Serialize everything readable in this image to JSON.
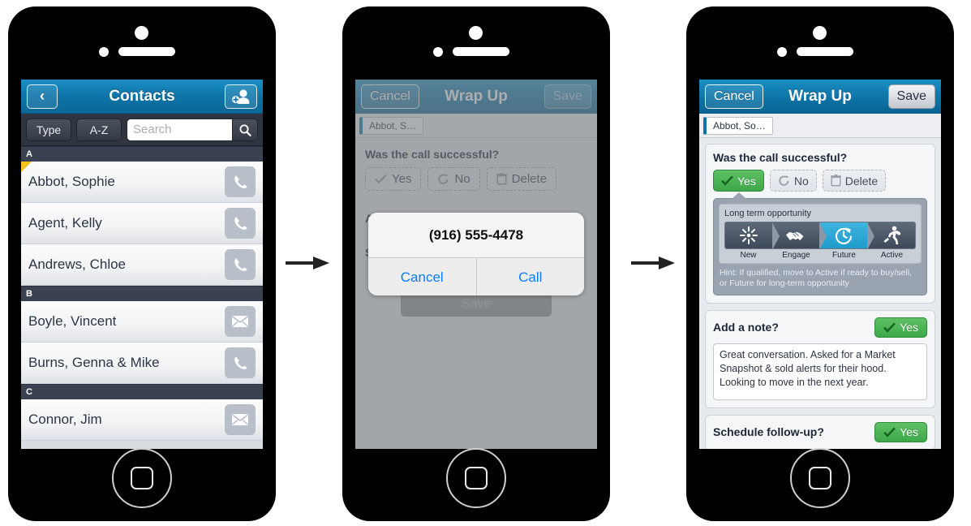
{
  "phones": [
    {
      "id": "contacts-phone"
    },
    {
      "id": "call-confirm-phone"
    },
    {
      "id": "wrapup-phone"
    }
  ],
  "screen1": {
    "navbar": {
      "back_label": "‹",
      "title": "Contacts",
      "add_contact_icon": "add-contact-icon"
    },
    "filters": {
      "type_label": "Type",
      "sort_label": "A-Z",
      "search_placeholder": "Search",
      "search_value": "",
      "search_icon": "search-icon"
    },
    "sections": [
      {
        "letter": "A",
        "contacts": [
          {
            "name": "Abbot, Sophie",
            "action": "phone-icon",
            "flagged": true
          },
          {
            "name": "Agent, Kelly",
            "action": "phone-icon",
            "flagged": false
          },
          {
            "name": "Andrews, Chloe",
            "action": "phone-icon",
            "flagged": false
          }
        ]
      },
      {
        "letter": "B",
        "contacts": [
          {
            "name": "Boyle, Vincent",
            "action": "envelope-icon",
            "flagged": false
          },
          {
            "name": "Burns, Genna & Mike",
            "action": "phone-icon",
            "flagged": false
          }
        ]
      },
      {
        "letter": "C",
        "contacts": [
          {
            "name": "Connor, Jim",
            "action": "envelope-icon",
            "flagged": false
          }
        ]
      }
    ]
  },
  "screen2": {
    "navbar": {
      "cancel_label": "Cancel",
      "title": "Wrap Up",
      "save_label": "Save",
      "save_enabled": false
    },
    "breadcrumb": "Abbot, S…",
    "question": "Was the call successful?",
    "choices": [
      {
        "label": "Yes",
        "icon": "check-icon"
      },
      {
        "label": "No",
        "icon": "undo-icon"
      },
      {
        "label": "Delete",
        "icon": "trash-icon"
      }
    ],
    "hidden_labels": {
      "note": "A",
      "followup": "S"
    },
    "save_button_label": "Save",
    "alert": {
      "message": "(916) 555-4478",
      "cancel_label": "Cancel",
      "call_label": "Call"
    }
  },
  "screen3": {
    "navbar": {
      "cancel_label": "Cancel",
      "title": "Wrap Up",
      "save_label": "Save",
      "save_enabled": true
    },
    "breadcrumb": "Abbot, So…",
    "call_card": {
      "question": "Was the call successful?",
      "choices": [
        {
          "label": "Yes",
          "icon": "check-icon",
          "selected": true
        },
        {
          "label": "No",
          "icon": "undo-icon",
          "selected": false
        },
        {
          "label": "Delete",
          "icon": "trash-icon",
          "selected": false
        }
      ],
      "stage_label": "Long term opportunity",
      "stages": [
        {
          "name": "New",
          "icon": "burst-icon",
          "active": false
        },
        {
          "name": "Engage",
          "icon": "handshake-icon",
          "active": false
        },
        {
          "name": "Future",
          "icon": "clock-arrow-icon",
          "active": true
        },
        {
          "name": "Active",
          "icon": "runner-icon",
          "active": false
        }
      ],
      "hint": "Hint: If qualified, move to Active if ready to buy/sell, or Future for long-term opportunity"
    },
    "note_card": {
      "question": "Add a note?",
      "toggle_label": "Yes",
      "note_text": "Great conversation. Asked for a Market Snapshot & sold alerts for their hood. Looking to move in the next year."
    },
    "followup_card": {
      "question": "Schedule follow-up?",
      "toggle_label": "Yes"
    }
  },
  "colors": {
    "nav_blue": "#0e74a8",
    "accent_green": "#3da84a",
    "stage_active_blue": "#1f9ccb",
    "alert_blue": "#0a7bff",
    "flag_yellow": "#f2c318"
  }
}
